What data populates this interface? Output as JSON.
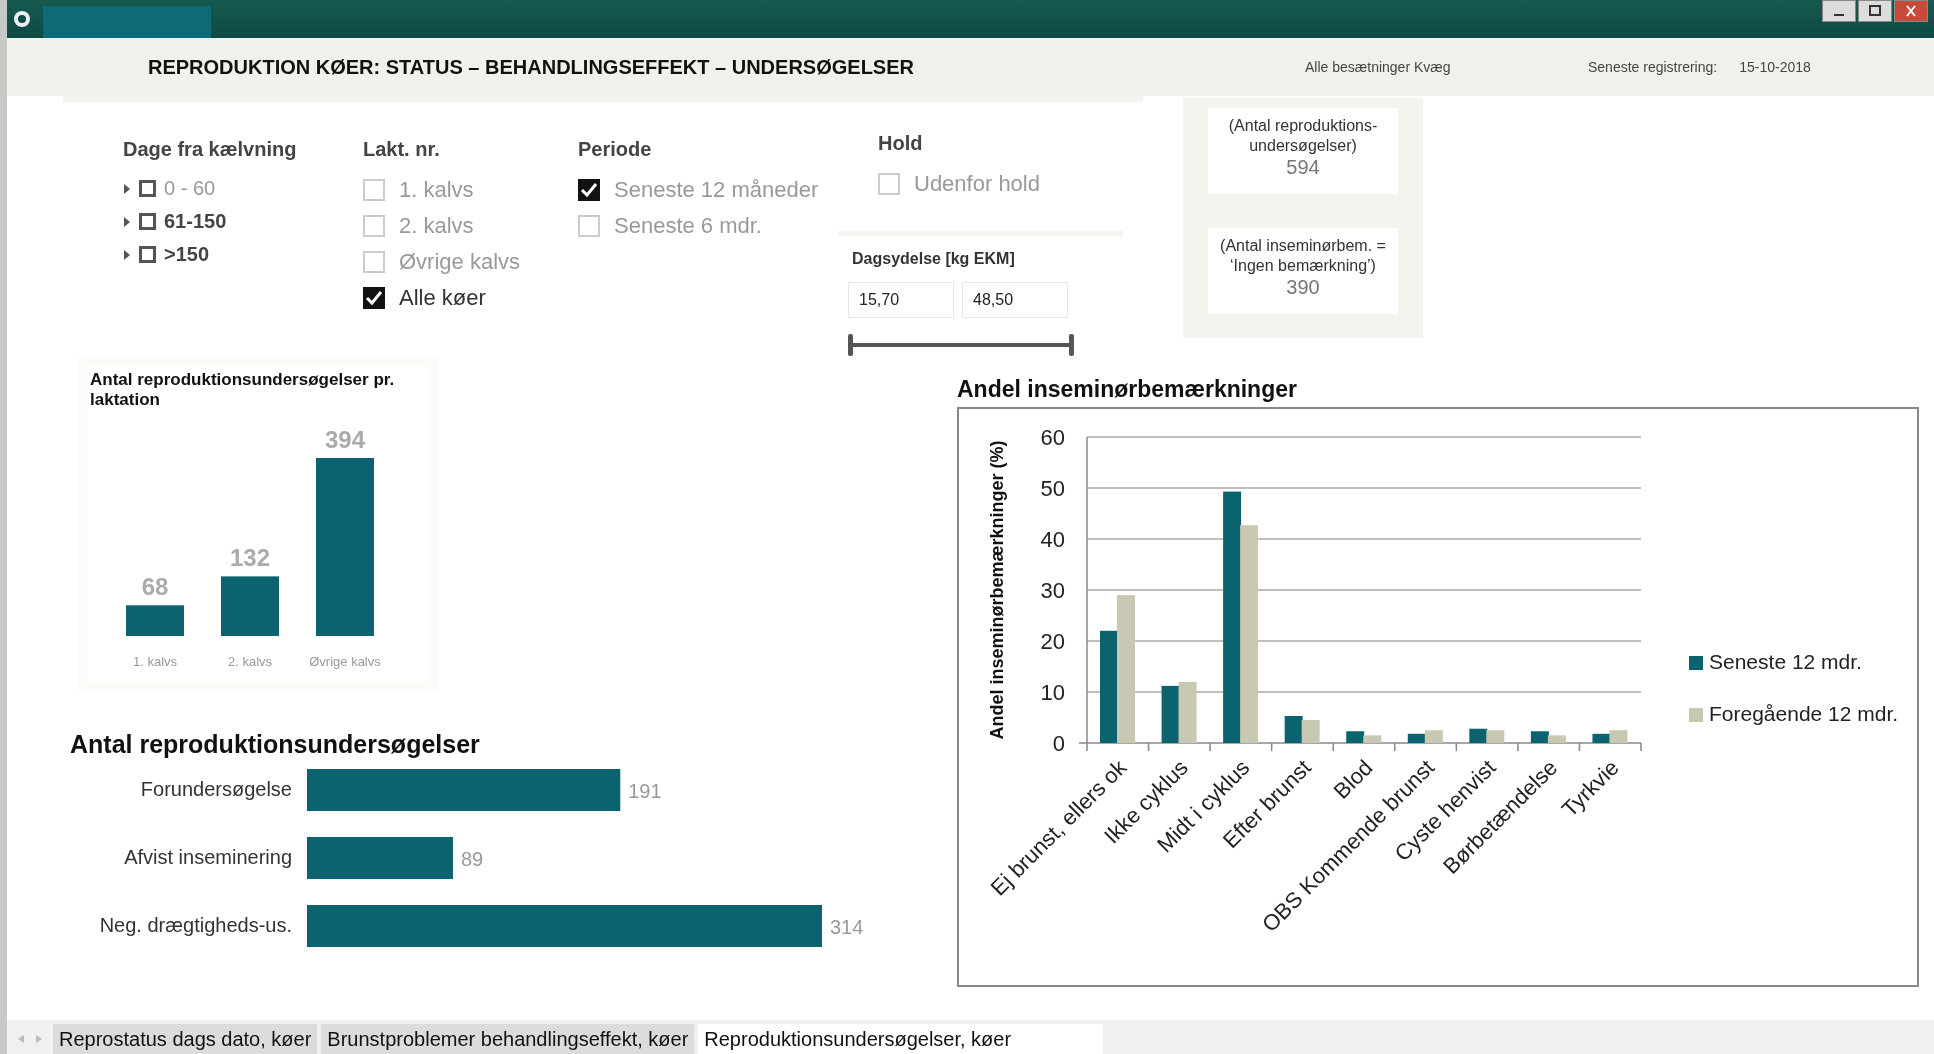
{
  "header": {
    "title": "REPRODUKTION KØER: STATUS – BEHANDLINGSEFFEKT – UNDERSØGELSER",
    "herd": "Alle besætninger Kvæg",
    "last_registration_label": "Seneste registrering:",
    "last_registration": "15-10-2018"
  },
  "filters": [
    {
      "title": "Dage fra kælvning",
      "items": [
        {
          "kind": "expandable",
          "label": "0 - 60",
          "checked": false,
          "disabled": true
        },
        {
          "kind": "expandable",
          "label": "61-150",
          "checked": false,
          "disabled": false
        },
        {
          "kind": "expandable",
          "label": ">150",
          "checked": false,
          "disabled": false
        }
      ]
    },
    {
      "title": "Lakt. nr.",
      "items": [
        {
          "kind": "checkbox",
          "label": "1. kalvs",
          "checked": false,
          "disabled": true
        },
        {
          "kind": "checkbox",
          "label": "2. kalvs",
          "checked": false,
          "disabled": true
        },
        {
          "kind": "checkbox",
          "label": "Øvrige kalvs",
          "checked": false,
          "disabled": true
        },
        {
          "kind": "checkbox",
          "label": "Alle køer",
          "checked": true,
          "disabled": false
        }
      ]
    },
    {
      "title": "Periode",
      "items": [
        {
          "kind": "checkbox",
          "label": "Seneste 12 måneder",
          "checked": true,
          "disabled": true
        },
        {
          "kind": "checkbox",
          "label": "Seneste 6 mdr.",
          "checked": false,
          "disabled": true
        }
      ]
    },
    {
      "title": "Hold",
      "items": [
        {
          "kind": "checkbox",
          "label": "Udenfor hold",
          "checked": false,
          "disabled": true
        }
      ]
    }
  ],
  "daily_yield": {
    "title": "Dagsydelse [kg EKM]",
    "min": "15,70",
    "max": "48,50",
    "level": 1
  },
  "summary": [
    {
      "label": "(Antal reproduktions-undersøgelser)",
      "value": "594"
    },
    {
      "label": "(Antal inseminørbem. = ‘Ingen bemærkning’)",
      "value": "390"
    }
  ],
  "lactation_chart": {
    "chart_data": {
      "type": "bar",
      "title": "Antal reproduktionsundersøgelser pr. laktation",
      "categories": [
        "1. kalvs",
        "2. kalvs",
        "Øvrige kalvs"
      ],
      "values": [
        68,
        132,
        394
      ],
      "data_labels": true
    }
  },
  "exam_chart": {
    "chart_data": {
      "type": "bar",
      "orientation": "horizontal",
      "title": "Antal reproduktionsundersøgelser",
      "categories": [
        "Forundersøgelse",
        "Afvist inseminering",
        "Neg. drægtigheds-us."
      ],
      "values": [
        191,
        89,
        314
      ],
      "data_labels": true
    }
  },
  "remarks_chart": {
    "chart_data": {
      "type": "bar",
      "title": "Andel inseminørbemærkninger",
      "ylabel": "Andel inseminørbemærkninger (%)",
      "categories": [
        "Ej brunst, ellers ok",
        "Ikke cyklus",
        "Midt i cyklus",
        "Efter brunst",
        "Blod",
        "OBS Kommende brunst",
        "Cyste henvist",
        "Børbetændelse",
        "Tyrkvie"
      ],
      "ylim": [
        0,
        60
      ],
      "grid": true,
      "legend": true,
      "yticks": [
        0,
        10,
        20,
        30,
        40,
        50,
        60
      ],
      "series": [
        {
          "name": "Seneste 12 mdr.",
          "color": "#0b6370",
          "values": [
            22,
            11.2,
            49.3,
            5.3,
            2.3,
            1.8,
            2.8,
            2.3,
            1.8
          ]
        },
        {
          "name": "Foregående 12 mdr.",
          "color": "#c9c8b3",
          "values": [
            29,
            12,
            42.7,
            4.5,
            1.5,
            2.5,
            2.5,
            1.5,
            2.5
          ]
        }
      ]
    }
  },
  "tabs": [
    {
      "label": "Reprostatus dags dato, køer",
      "selected": false
    },
    {
      "label": "Brunstproblemer behandlingseffekt, køer",
      "selected": false
    },
    {
      "label": "Reproduktionsundersøgelser, køer",
      "selected": true
    }
  ]
}
